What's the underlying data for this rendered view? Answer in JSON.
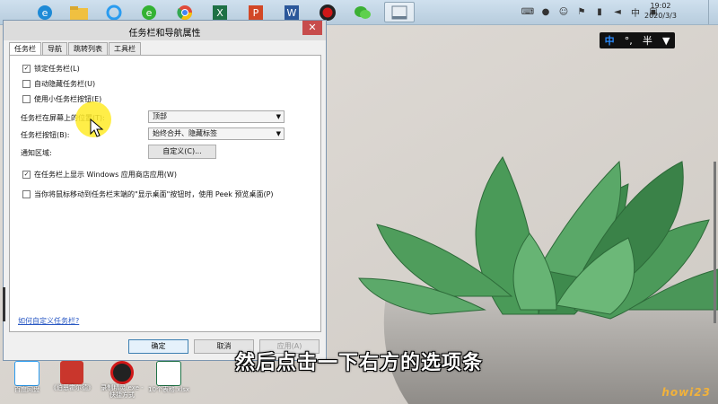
{
  "taskbar": {
    "apps": [
      {
        "name": "browser-ie",
        "color": "#1e8ad6"
      },
      {
        "name": "file-explorer",
        "color": "#f0c040"
      },
      {
        "name": "baidu-cloud",
        "color": "#2a9cf0"
      },
      {
        "name": "browser-360",
        "color": "#33b233"
      },
      {
        "name": "chrome",
        "color": "#e04a3a"
      },
      {
        "name": "excel",
        "color": "#1e7145"
      },
      {
        "name": "powerpoint",
        "color": "#d24726"
      },
      {
        "name": "word",
        "color": "#2b579a"
      },
      {
        "name": "recorder",
        "color": "#d01818"
      },
      {
        "name": "wechat",
        "color": "#3cb034"
      },
      {
        "name": "taskbar-properties",
        "color": "#6a7e90"
      }
    ],
    "clock_time": "19:02",
    "clock_date": "2020/3/3"
  },
  "ime": {
    "lang": "中",
    "punct": "°,",
    "width": "半"
  },
  "dialog": {
    "title": "任务栏和导航属性",
    "tabs": [
      "任务栏",
      "导航",
      "跳转列表",
      "工具栏"
    ],
    "options": {
      "lock": {
        "label": "锁定任务栏(L)",
        "checked": true
      },
      "autohide": {
        "label": "自动隐藏任务栏(U)",
        "checked": false
      },
      "small": {
        "label": "使用小任务栏按钮(E)",
        "checked": false
      },
      "position_label": "任务栏在屏幕上的位置(T):",
      "position_value": "顶部",
      "buttons_label": "任务栏按钮(B):",
      "buttons_value": "始终合并、隐藏标签",
      "notify_label": "通知区域:",
      "customize_btn": "自定义(C)...",
      "store": {
        "label": "在任务栏上显示 Windows 应用商店应用(W)",
        "checked": true
      },
      "peek": {
        "label": "当你将鼠标移动到任务栏末端的\"显示桌面\"按钮时，使用 Peek 预览桌面(P)",
        "checked": false
      }
    },
    "help_link": "如何自定义任务栏?",
    "ok": "确定",
    "cancel": "取消",
    "apply": "应用(A)"
  },
  "desktop_icons": [
    {
      "label": "百度网盘",
      "color": "#2a9cf0"
    },
    {
      "label": "《伯恩霍尔德》",
      "color": "#c9362c"
    },
    {
      "label": "录制精灵.exe - 快捷方式",
      "color": "#d01818"
    },
    {
      "label": "10个表格.xlsx",
      "color": "#1e7145"
    }
  ],
  "subtitle": "然后点击一下右方的选项条",
  "watermark": "howi23"
}
